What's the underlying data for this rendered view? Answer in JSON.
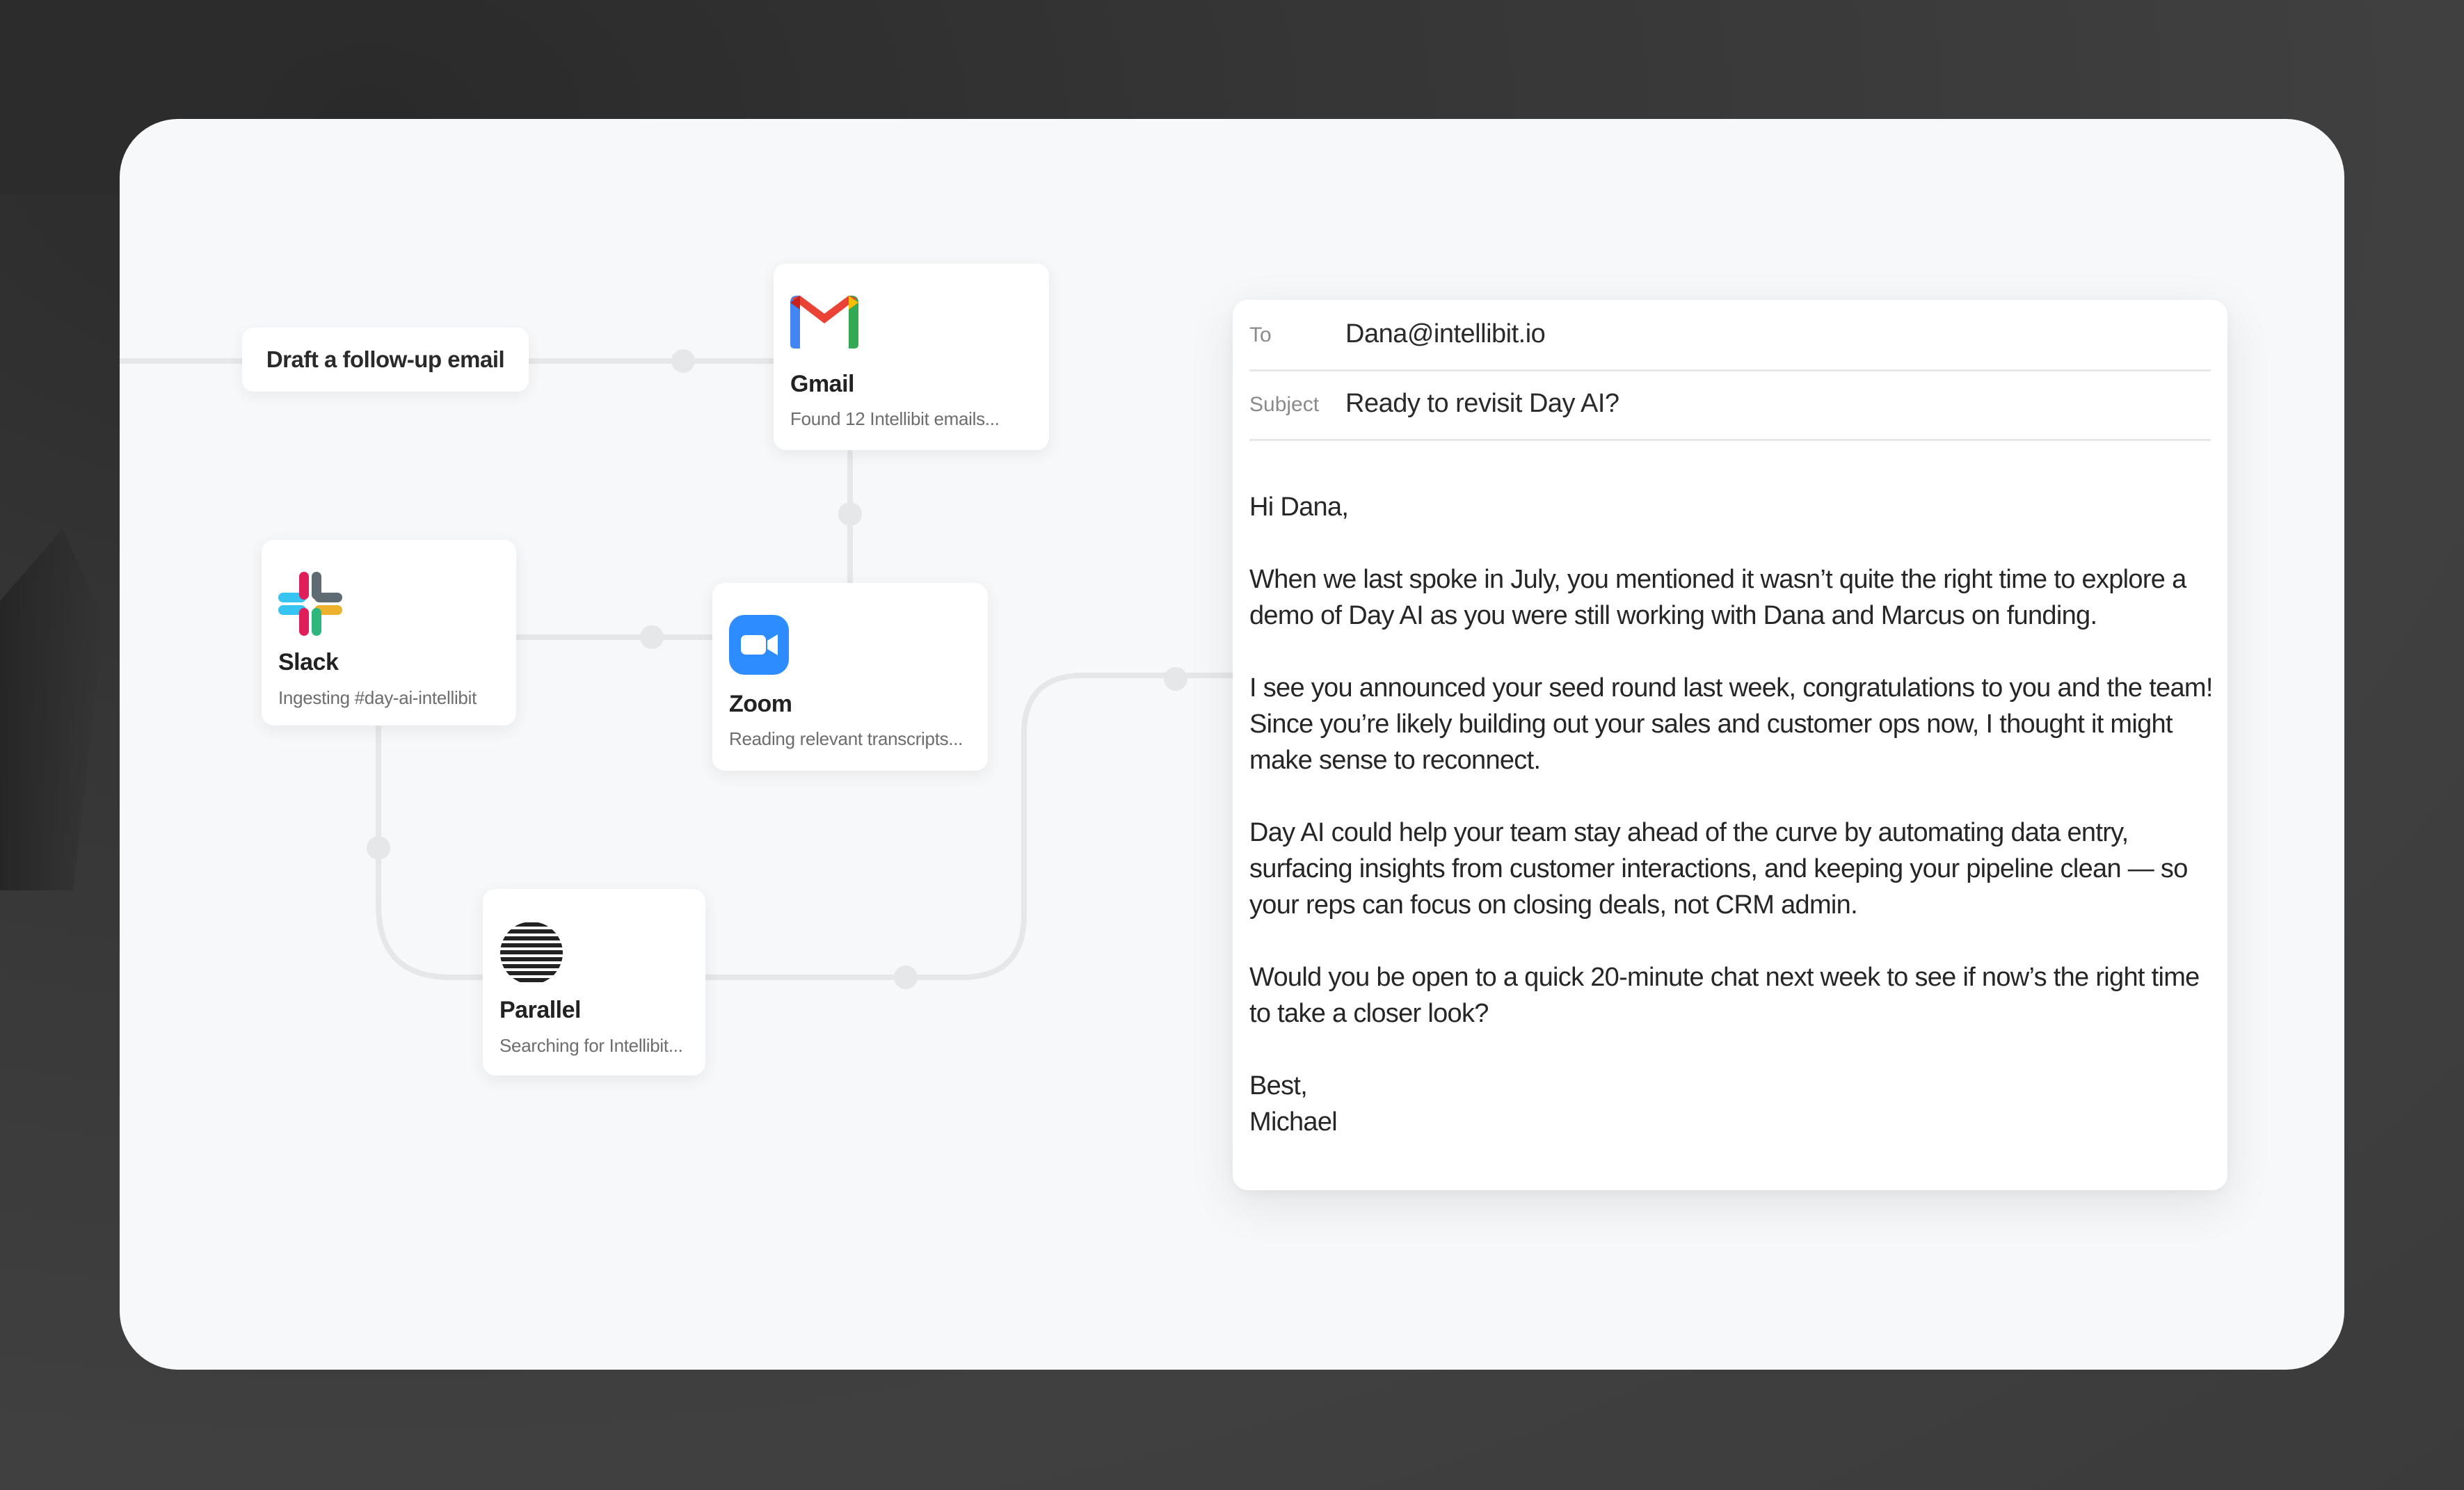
{
  "prompt_chip": {
    "label": "Draft a follow-up email"
  },
  "nodes": {
    "gmail": {
      "title": "Gmail",
      "subtitle": "Found 12 Intellibit emails..."
    },
    "slack": {
      "title": "Slack",
      "subtitle": "Ingesting #day-ai-intellibit"
    },
    "zoom": {
      "title": "Zoom",
      "subtitle": "Reading relevant transcripts..."
    },
    "parallel": {
      "title": "Parallel",
      "subtitle": "Searching for Intellibit..."
    }
  },
  "email": {
    "to_label": "To",
    "to_value": "Dana@intellibit.io",
    "subject_label": "Subject",
    "subject_value": "Ready to revisit Day AI?",
    "greeting": "Hi Dana,",
    "paragraphs": [
      "When we last spoke in July, you mentioned it wasn’t quite the right time to explore a demo of Day AI as you were still working with Dana and Marcus on funding.",
      "I see you announced your seed round last week, congratulations to you and the team! Since you’re likely building out your sales and customer ops now, I thought it might make sense to reconnect.",
      "Day AI could help your team stay ahead of the curve by automating data entry, surfacing insights from customer interactions, and keeping your pipeline clean — so your reps can focus on closing deals, not CRM admin.",
      "Would you be open to a quick 20-minute chat next week to see if now’s the right time to take a closer look?"
    ],
    "signoff": "Best,",
    "signature": "Michael"
  },
  "colors": {
    "background": "#3d3d3d",
    "card": "#f7f8fa",
    "connector": "#e6e7e9",
    "gmail_red": "#ea4335",
    "gmail_blue": "#4285f4",
    "gmail_green": "#34a853",
    "gmail_yellow": "#fbbc04",
    "zoom_blue": "#2d8cff",
    "slack_blue": "#36c5f0",
    "slack_green": "#2eb67d",
    "slack_red": "#e01e5a",
    "slack_yellow": "#ecb22e"
  }
}
